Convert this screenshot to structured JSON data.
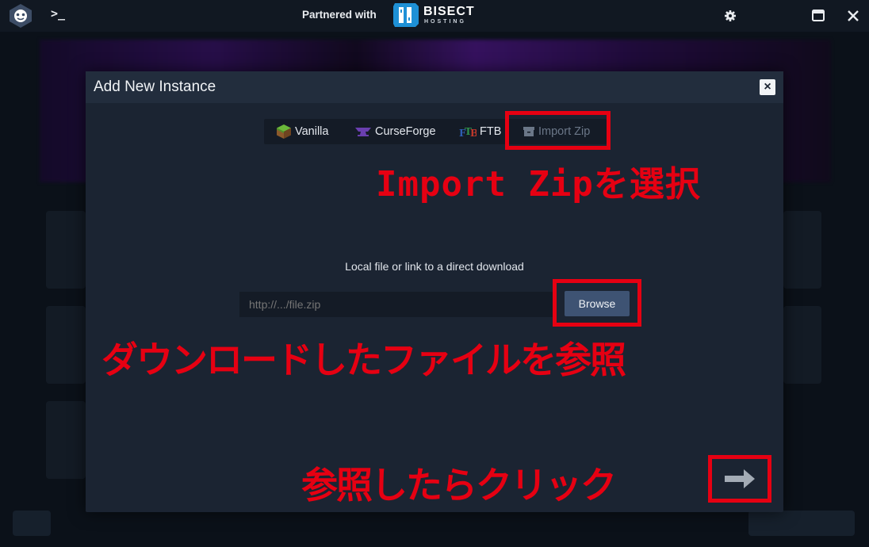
{
  "titlebar": {
    "partner_text": "Partnered with",
    "sponsor_name": "BISECT",
    "sponsor_sub": "HOSTING",
    "icons": [
      "app-logo-icon",
      "terminal-icon",
      "gear-icon",
      "minimize-icon",
      "close-icon"
    ]
  },
  "modal": {
    "title": "Add New Instance",
    "close_label": "×",
    "tabs": [
      {
        "label": "Vanilla",
        "icon": "grass-block-icon"
      },
      {
        "label": "CurseForge",
        "icon": "anvil-icon"
      },
      {
        "label": "FTB",
        "icon": "ftb-icon"
      },
      {
        "label": "Import Zip",
        "icon": "archive-icon",
        "state": "selected"
      }
    ],
    "field_label": "Local file or link to a direct download",
    "url_placeholder": "http://.../file.zip",
    "browse_label": "Browse",
    "next_icon": "arrow-right-icon"
  },
  "annotations": {
    "step1": "Import Zipを選択",
    "step2": "ダウンロードしたファイルを参照",
    "step3": "参照したらクリック",
    "color": "#e60012"
  },
  "colors": {
    "background": "#0b1119",
    "modal": "#1b2432",
    "browse_button": "#3e5373",
    "accent_red": "#e60012"
  }
}
